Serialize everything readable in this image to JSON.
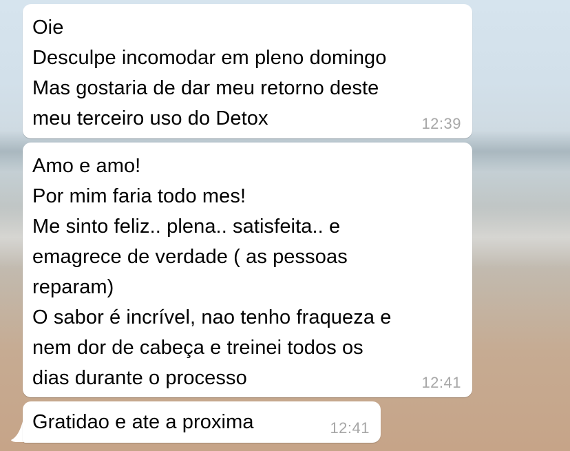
{
  "messages": [
    {
      "text": "Oie\nDesculpe incomodar em pleno domingo\nMas gostaria de dar meu retorno deste\nmeu terceiro uso do Detox",
      "time": "12:39"
    },
    {
      "text": "Amo e amo!\nPor mim faria todo mes!\nMe sinto feliz.. plena.. satisfeita.. e\nemagrece de verdade ( as pessoas\nreparam)\nO sabor é incrível, nao tenho fraqueza e\nnem dor de cabeça e treinei todos os\ndias durante o processo",
      "time": "12:41"
    },
    {
      "text": "Gratidao e ate a proxima",
      "time": "12:41"
    }
  ],
  "colors": {
    "bubble": "#ffffff",
    "text": "#000000",
    "timestamp": "#a7a7a7"
  }
}
